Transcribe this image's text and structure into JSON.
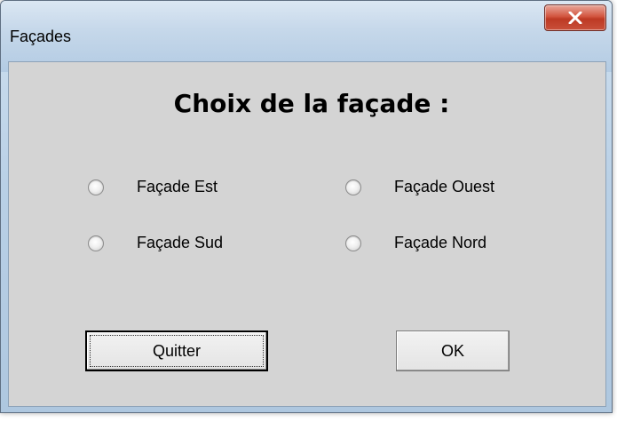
{
  "window": {
    "title": "Façades",
    "close_icon": "close-icon"
  },
  "form": {
    "heading": "Choix de la façade :",
    "options": [
      {
        "label": "Façade Est",
        "selected": false
      },
      {
        "label": "Façade Ouest",
        "selected": false
      },
      {
        "label": "Façade Sud",
        "selected": false
      },
      {
        "label": "Façade Nord",
        "selected": false
      }
    ],
    "buttons": {
      "quit_label": "Quitter",
      "ok_label": "OK"
    }
  },
  "colors": {
    "client_bg": "#d4d4d4",
    "close_button": "#c9503a"
  }
}
